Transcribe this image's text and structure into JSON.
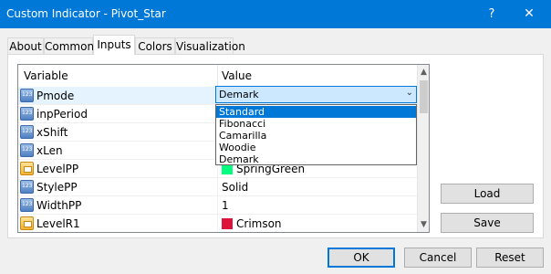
{
  "window": {
    "title": "Custom Indicator - Pivot_Star",
    "help_glyph": "?",
    "close_glyph": "✕"
  },
  "tabs": [
    {
      "label": "About"
    },
    {
      "label": "Common"
    },
    {
      "label": "Inputs"
    },
    {
      "label": "Colors"
    },
    {
      "label": "Visualization"
    }
  ],
  "grid": {
    "headers": {
      "variable": "Variable",
      "value": "Value"
    },
    "rows": [
      {
        "name": "Pmode",
        "value": "Demark",
        "icon": "number-icon"
      },
      {
        "name": "inpPeriod",
        "value": "",
        "icon": "number-icon"
      },
      {
        "name": "xShift",
        "value": "",
        "icon": "number-icon"
      },
      {
        "name": "xLen",
        "value": "",
        "icon": "number-icon"
      },
      {
        "name": "LevelPP",
        "value": "SpringGreen",
        "icon": "color-icon",
        "swatch": "#00ff7f"
      },
      {
        "name": "StylePP",
        "value": "Solid",
        "icon": "number-icon"
      },
      {
        "name": "WidthPP",
        "value": "1",
        "icon": "number-icon"
      },
      {
        "name": "LevelR1",
        "value": "Crimson",
        "icon": "color-icon",
        "swatch": "#dc143c"
      }
    ]
  },
  "combo": {
    "value": "Demark",
    "arrow": "⌄"
  },
  "dropdown": {
    "options": [
      "Standard",
      "Fibonacci",
      "Camarilla",
      "Woodie",
      "Demark"
    ],
    "highlighted": "Standard"
  },
  "side_buttons": {
    "load": "Load",
    "save": "Save"
  },
  "footer_buttons": {
    "ok": "OK",
    "cancel": "Cancel",
    "reset": "Reset"
  },
  "colors": {
    "titlebar": "#0078d7",
    "selection": "#0078d7"
  }
}
